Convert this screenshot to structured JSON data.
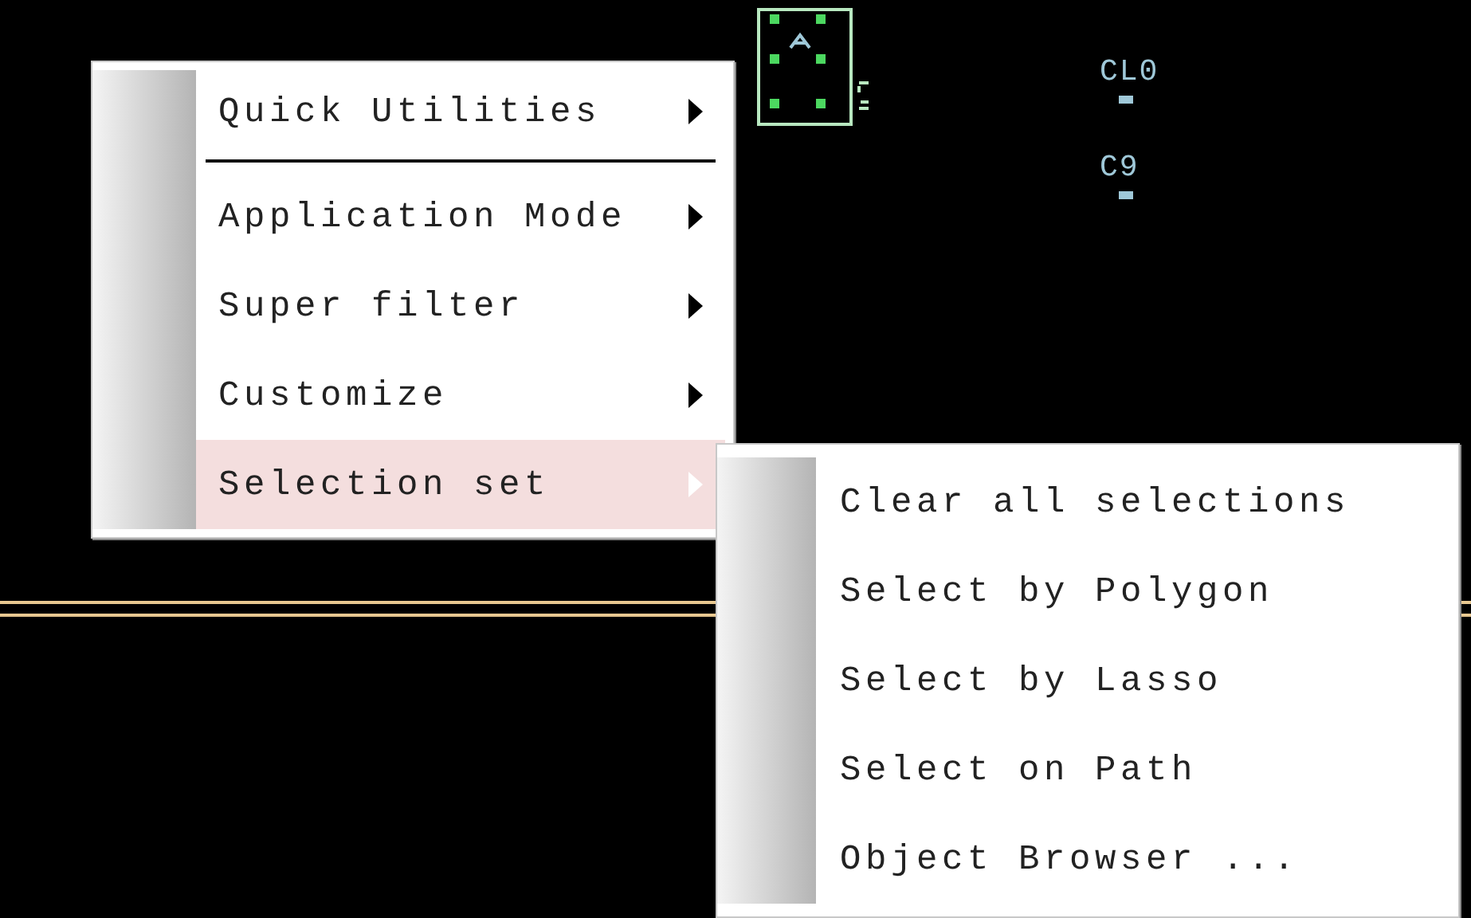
{
  "canvas": {
    "labels": [
      {
        "text": "CL0"
      },
      {
        "text": "C9"
      }
    ]
  },
  "context_menu": {
    "items": [
      {
        "kind": "item",
        "label": "Quick Utilities",
        "submenu": true,
        "selected": false
      },
      {
        "kind": "separator"
      },
      {
        "kind": "item",
        "label": "Application Mode",
        "submenu": true,
        "selected": false
      },
      {
        "kind": "item",
        "label": "Super filter",
        "submenu": true,
        "selected": false
      },
      {
        "kind": "item",
        "label": "Customize",
        "submenu": true,
        "selected": false
      },
      {
        "kind": "item",
        "label": "Selection set",
        "submenu": true,
        "selected": true
      }
    ]
  },
  "submenu": {
    "items": [
      {
        "label": "Clear all selections",
        "selected": false
      },
      {
        "label": "Select by Polygon",
        "selected": false
      },
      {
        "label": "Select by Lasso",
        "selected": false
      },
      {
        "label": "Select on Path",
        "selected": false
      },
      {
        "label": "Object Browser ...",
        "selected": false
      }
    ]
  }
}
